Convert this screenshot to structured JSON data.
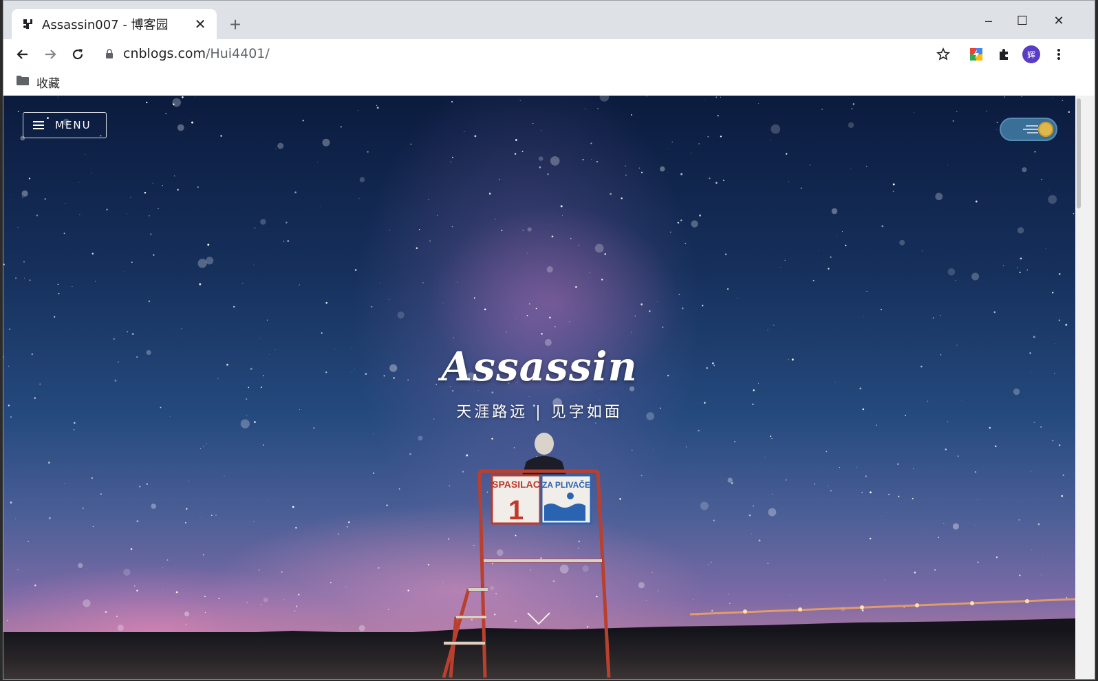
{
  "browser": {
    "tab": {
      "title": "Assassin007 - 博客园",
      "close_glyph": "✕"
    },
    "new_tab_glyph": "+",
    "window_controls": {
      "minimize": "–",
      "maximize": "☐",
      "close": "✕"
    },
    "address": {
      "host": "cnblogs.com",
      "path": "/Hui4401/"
    },
    "profile_initial": "辉",
    "bookmarks": [
      {
        "label": "收藏",
        "icon": "folder-icon"
      }
    ]
  },
  "page": {
    "menu_label": "MENU",
    "hero_title": "Assassin",
    "hero_subtitle": "天涯路远 | 见字如面",
    "scene_signs": {
      "left": "SPASILAC",
      "left_number": "1",
      "right": "ZA PLIVAČE"
    }
  },
  "colors": {
    "accent_toggle": "#3a6f97",
    "toggle_knob": "#e0b84a",
    "avatar": "#5b3cc4"
  }
}
